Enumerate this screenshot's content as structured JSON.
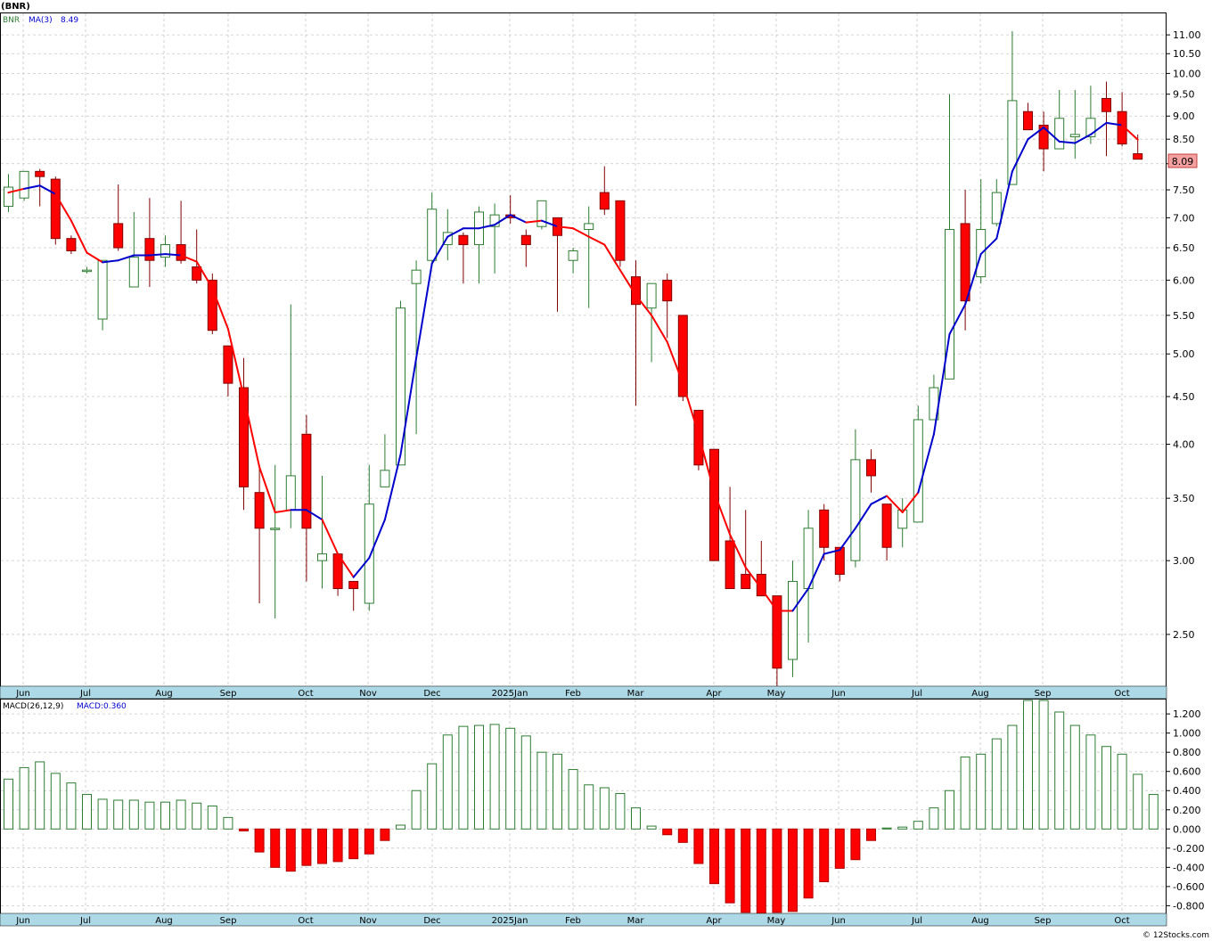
{
  "header": {
    "symbol_title": "(BNR)"
  },
  "legend": {
    "symbol": "BNR",
    "ma_label": "MA(3)",
    "ma_value": "8.49",
    "macd_label": "MACD(26,12,9)",
    "macd_value": "MACD:0.360"
  },
  "price_tag": "8.09",
  "footer": "© 12Stocks.com",
  "colors": {
    "up": "#2e7d32",
    "down": "#ff0000",
    "ma_up": "#0000cc",
    "ma_down": "#ff0000",
    "grid": "#c8c8c8",
    "axis_band": "#add8e6"
  },
  "chart_data": [
    {
      "type": "candlestick",
      "title": "(BNR)",
      "scale": "log",
      "ylim": [
        2.2,
        11.6
      ],
      "y_ticks": [
        "11.00",
        "10.50",
        "10.00",
        "9.50",
        "9.00",
        "8.50",
        "8.00",
        "7.50",
        "7.00",
        "6.50",
        "6.00",
        "5.50",
        "5.00",
        "4.50",
        "4.00",
        "3.50",
        "3.00",
        "2.50"
      ],
      "x_month_labels": [
        "Jun",
        "Jul",
        "Aug",
        "Sep",
        "Oct",
        "Nov",
        "Dec",
        "2025Jan",
        "Feb",
        "Mar",
        "Apr",
        "May",
        "Jun",
        "Jul",
        "Aug",
        "Sep",
        "Oct"
      ],
      "candles": [
        {
          "o": 7.2,
          "h": 7.8,
          "l": 7.1,
          "c": 7.55
        },
        {
          "o": 7.35,
          "h": 7.85,
          "l": 7.3,
          "c": 7.85
        },
        {
          "o": 7.85,
          "h": 7.9,
          "l": 7.2,
          "c": 7.75
        },
        {
          "o": 7.7,
          "h": 7.75,
          "l": 6.55,
          "c": 6.65
        },
        {
          "o": 6.65,
          "h": 6.7,
          "l": 6.4,
          "c": 6.45
        },
        {
          "o": 6.15,
          "h": 6.2,
          "l": 6.1,
          "c": 6.15
        },
        {
          "o": 5.45,
          "h": 6.3,
          "l": 5.3,
          "c": 6.3
        },
        {
          "o": 6.9,
          "h": 7.6,
          "l": 6.45,
          "c": 6.5
        },
        {
          "o": 5.9,
          "h": 7.1,
          "l": 5.9,
          "c": 6.35
        },
        {
          "o": 6.65,
          "h": 7.35,
          "l": 5.9,
          "c": 6.3
        },
        {
          "o": 6.35,
          "h": 6.7,
          "l": 6.2,
          "c": 6.55
        },
        {
          "o": 6.55,
          "h": 7.3,
          "l": 6.25,
          "c": 6.3
        },
        {
          "o": 6.2,
          "h": 6.8,
          "l": 5.95,
          "c": 6.0
        },
        {
          "o": 6.0,
          "h": 6.1,
          "l": 5.25,
          "c": 5.3
        },
        {
          "o": 5.1,
          "h": 5.1,
          "l": 4.5,
          "c": 4.65
        },
        {
          "o": 4.6,
          "h": 4.95,
          "l": 3.4,
          "c": 3.6
        },
        {
          "o": 3.55,
          "h": 3.8,
          "l": 2.7,
          "c": 3.25
        },
        {
          "o": 3.25,
          "h": 3.8,
          "l": 2.6,
          "c": 3.25
        },
        {
          "o": 3.4,
          "h": 5.65,
          "l": 3.25,
          "c": 3.7
        },
        {
          "o": 4.1,
          "h": 4.3,
          "l": 2.85,
          "c": 3.25
        },
        {
          "o": 3.0,
          "h": 3.7,
          "l": 2.8,
          "c": 3.05
        },
        {
          "o": 3.05,
          "h": 3.05,
          "l": 2.75,
          "c": 2.8
        },
        {
          "o": 2.85,
          "h": 2.85,
          "l": 2.65,
          "c": 2.8
        },
        {
          "o": 2.7,
          "h": 3.8,
          "l": 2.65,
          "c": 3.45
        },
        {
          "o": 3.6,
          "h": 4.1,
          "l": 3.6,
          "c": 3.75
        },
        {
          "o": 3.8,
          "h": 5.7,
          "l": 3.8,
          "c": 5.6
        },
        {
          "o": 5.95,
          "h": 6.3,
          "l": 4.1,
          "c": 6.15
        },
        {
          "o": 6.3,
          "h": 7.45,
          "l": 6.2,
          "c": 7.15
        },
        {
          "o": 6.55,
          "h": 7.15,
          "l": 6.3,
          "c": 6.75
        },
        {
          "o": 6.7,
          "h": 6.75,
          "l": 5.95,
          "c": 6.55
        },
        {
          "o": 6.55,
          "h": 7.2,
          "l": 5.95,
          "c": 7.1
        },
        {
          "o": 6.85,
          "h": 7.25,
          "l": 6.1,
          "c": 7.05
        },
        {
          "o": 7.05,
          "h": 7.4,
          "l": 6.9,
          "c": 7.0
        },
        {
          "o": 6.7,
          "h": 6.8,
          "l": 6.2,
          "c": 6.55
        },
        {
          "o": 6.85,
          "h": 7.3,
          "l": 6.8,
          "c": 7.3
        },
        {
          "o": 7.0,
          "h": 7.0,
          "l": 5.55,
          "c": 6.7
        },
        {
          "o": 6.3,
          "h": 6.5,
          "l": 6.1,
          "c": 6.45
        },
        {
          "o": 6.8,
          "h": 7.2,
          "l": 5.6,
          "c": 6.9
        },
        {
          "o": 7.45,
          "h": 7.95,
          "l": 7.05,
          "c": 7.15
        },
        {
          "o": 7.3,
          "h": 7.3,
          "l": 6.2,
          "c": 6.3
        },
        {
          "o": 6.05,
          "h": 6.3,
          "l": 4.4,
          "c": 5.65
        },
        {
          "o": 5.6,
          "h": 5.95,
          "l": 4.9,
          "c": 5.95
        },
        {
          "o": 6.0,
          "h": 6.1,
          "l": 5.2,
          "c": 5.7
        },
        {
          "o": 5.5,
          "h": 5.5,
          "l": 4.45,
          "c": 4.5
        },
        {
          "o": 4.35,
          "h": 4.35,
          "l": 3.75,
          "c": 3.8
        },
        {
          "o": 3.95,
          "h": 3.95,
          "l": 3.0,
          "c": 3.0
        },
        {
          "o": 3.15,
          "h": 3.6,
          "l": 2.8,
          "c": 2.8
        },
        {
          "o": 2.9,
          "h": 3.4,
          "l": 2.8,
          "c": 2.8
        },
        {
          "o": 2.9,
          "h": 3.15,
          "l": 2.75,
          "c": 2.75
        },
        {
          "o": 2.75,
          "h": 2.75,
          "l": 2.15,
          "c": 2.3
        },
        {
          "o": 2.35,
          "h": 3.0,
          "l": 2.25,
          "c": 2.85
        },
        {
          "o": 2.8,
          "h": 3.4,
          "l": 2.45,
          "c": 3.25
        },
        {
          "o": 3.4,
          "h": 3.45,
          "l": 3.0,
          "c": 3.1
        },
        {
          "o": 3.1,
          "h": 3.1,
          "l": 2.85,
          "c": 2.9
        },
        {
          "o": 3.0,
          "h": 4.15,
          "l": 2.95,
          "c": 3.85
        },
        {
          "o": 3.85,
          "h": 3.95,
          "l": 3.55,
          "c": 3.7
        },
        {
          "o": 3.45,
          "h": 3.45,
          "l": 3.0,
          "c": 3.1
        },
        {
          "o": 3.25,
          "h": 3.5,
          "l": 3.1,
          "c": 3.4
        },
        {
          "o": 3.3,
          "h": 4.4,
          "l": 3.3,
          "c": 4.25
        },
        {
          "o": 4.25,
          "h": 4.75,
          "l": 4.25,
          "c": 4.6
        },
        {
          "o": 4.7,
          "h": 9.5,
          "l": 4.7,
          "c": 6.8
        },
        {
          "o": 6.9,
          "h": 7.5,
          "l": 5.3,
          "c": 5.7
        },
        {
          "o": 6.05,
          "h": 7.7,
          "l": 5.95,
          "c": 6.8
        },
        {
          "o": 6.9,
          "h": 7.7,
          "l": 6.85,
          "c": 7.45
        },
        {
          "o": 7.6,
          "h": 11.1,
          "l": 7.6,
          "c": 9.35
        },
        {
          "o": 9.1,
          "h": 9.3,
          "l": 8.7,
          "c": 8.7
        },
        {
          "o": 8.8,
          "h": 9.1,
          "l": 7.85,
          "c": 8.3
        },
        {
          "o": 8.3,
          "h": 9.6,
          "l": 8.3,
          "c": 8.95
        },
        {
          "o": 8.55,
          "h": 9.6,
          "l": 8.1,
          "c": 8.6
        },
        {
          "o": 8.55,
          "h": 9.7,
          "l": 8.4,
          "c": 8.95
        },
        {
          "o": 9.4,
          "h": 9.8,
          "l": 8.15,
          "c": 9.1
        },
        {
          "o": 9.1,
          "h": 9.55,
          "l": 8.35,
          "c": 8.4
        },
        {
          "o": 8.2,
          "h": 8.6,
          "l": 8.1,
          "c": 8.09
        }
      ],
      "ma3": [
        7.45,
        7.52,
        7.58,
        7.42,
        6.95,
        6.42,
        6.27,
        6.3,
        6.38,
        6.38,
        6.4,
        6.38,
        6.28,
        5.88,
        5.32,
        4.5,
        3.78,
        3.38,
        3.4,
        3.4,
        3.32,
        3.05,
        2.88,
        3.02,
        3.32,
        3.9,
        4.95,
        6.25,
        6.68,
        6.82,
        6.82,
        6.88,
        7.05,
        6.92,
        6.95,
        6.85,
        6.82,
        6.68,
        6.55,
        6.15,
        5.78,
        5.5,
        5.15,
        4.65,
        4.1,
        3.55,
        3.2,
        2.95,
        2.8,
        2.65,
        2.65,
        2.8,
        3.05,
        3.08,
        3.25,
        3.45,
        3.52,
        3.38,
        3.55,
        4.1,
        5.25,
        5.65,
        6.4,
        6.65,
        7.85,
        8.5,
        8.75,
        8.45,
        8.42,
        8.6,
        8.85,
        8.8,
        8.49
      ],
      "ma_color_index": [
        1,
        0,
        0,
        1,
        1,
        1,
        0,
        0,
        0,
        0,
        0,
        1,
        1,
        1,
        1,
        1,
        1,
        1,
        0,
        0,
        1,
        1,
        0,
        0,
        0,
        0,
        0,
        0,
        0,
        0,
        0,
        0,
        0,
        1,
        0,
        1,
        1,
        1,
        1,
        1,
        1,
        1,
        1,
        1,
        1,
        1,
        1,
        1,
        1,
        1,
        0,
        0,
        0,
        0,
        0,
        0,
        1,
        1,
        0,
        0,
        0,
        0,
        0,
        0,
        0,
        0,
        0,
        0,
        0,
        0,
        0,
        1,
        1
      ]
    },
    {
      "type": "bar",
      "title": "MACD(26,12,9)",
      "ylim": [
        -0.88,
        1.35
      ],
      "y_ticks": [
        "1.200",
        "1.000",
        "0.800",
        "0.600",
        "0.400",
        "0.200",
        "0.000",
        "-0.200",
        "-0.400",
        "-0.600",
        "-0.800"
      ],
      "x_month_labels": [
        "Jun",
        "Jul",
        "Aug",
        "Sep",
        "Oct",
        "Nov",
        "Dec",
        "2025Jan",
        "Feb",
        "Mar",
        "Apr",
        "May",
        "Jun",
        "Jul",
        "Aug",
        "Sep",
        "Oct"
      ],
      "values": [
        0.52,
        0.64,
        0.7,
        0.58,
        0.48,
        0.36,
        0.31,
        0.3,
        0.3,
        0.28,
        0.28,
        0.3,
        0.27,
        0.24,
        0.12,
        -0.02,
        -0.24,
        -0.4,
        -0.44,
        -0.38,
        -0.36,
        -0.34,
        -0.31,
        -0.26,
        -0.12,
        0.04,
        0.4,
        0.68,
        0.98,
        1.07,
        1.08,
        1.09,
        1.05,
        0.97,
        0.8,
        0.78,
        0.62,
        0.46,
        0.43,
        0.37,
        0.22,
        0.03,
        -0.06,
        -0.14,
        -0.36,
        -0.57,
        -0.77,
        -0.87,
        -0.88,
        -0.87,
        -0.86,
        -0.72,
        -0.55,
        -0.41,
        -0.32,
        -0.12,
        0.01,
        0.02,
        0.08,
        0.22,
        0.4,
        0.75,
        0.78,
        0.94,
        1.08,
        1.34,
        1.34,
        1.22,
        1.08,
        0.98,
        0.86,
        0.78,
        0.57,
        0.36
      ]
    }
  ]
}
